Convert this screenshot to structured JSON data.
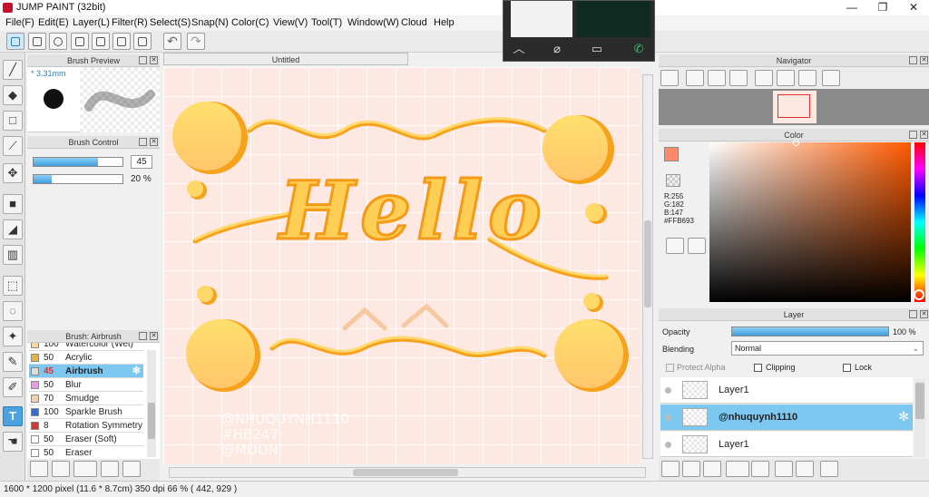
{
  "window": {
    "title": "JUMP PAINT (32bit)",
    "min": "—",
    "max": "❐",
    "close": "✕"
  },
  "menu": [
    "File(F)",
    "Edit(E)",
    "Layer(L)",
    "Filter(R)",
    "Select(S)",
    "Snap(N)",
    "Color(C)",
    "View(V)",
    "Tool(T)",
    "Window(W)",
    "Cloud",
    "Help"
  ],
  "panels": {
    "brush_preview": {
      "title": "Brush Preview",
      "size": "* 3.31mm"
    },
    "brush_control": {
      "title": "Brush Control",
      "size_value": "45",
      "size_fill": 0.72,
      "opacity_value": "20 %",
      "opacity_fill": 0.2
    },
    "brush_list": {
      "title": "Brush: Airbrush",
      "items": [
        {
          "size": "100",
          "name": "Watercolor (Wet)",
          "color": "#f7d89a"
        },
        {
          "size": "50",
          "name": "Acrylic",
          "color": "#e8b53c"
        },
        {
          "size": "45",
          "name": "Airbrush",
          "color": "#4aa3df"
        },
        {
          "size": "50",
          "name": "Blur",
          "color": "#e79be8"
        },
        {
          "size": "70",
          "name": "Smudge",
          "color": "#f4cfa7"
        },
        {
          "size": "100",
          "name": "Sparkle Brush",
          "color": "#2f6ed8"
        },
        {
          "size": "8",
          "name": "Rotation Symmetry P",
          "color": "#e03030"
        },
        {
          "size": "50",
          "name": "Eraser (Soft)",
          "color": "#ffffff"
        },
        {
          "size": "50",
          "name": "Eraser",
          "color": "#ffffff"
        }
      ]
    },
    "document": {
      "tab": "Untitled"
    },
    "navigator": {
      "title": "Navigator"
    },
    "color": {
      "title": "Color",
      "r": "R:255",
      "g": "G:182",
      "b": "B:147",
      "hex": "#FFB693",
      "current": "#ff8a6a"
    },
    "layer": {
      "title": "Layer",
      "opacity_label": "Opacity",
      "opacity_value": "100 %",
      "opacity_fill": 1.0,
      "blending_label": "Blending",
      "blending_value": "Normal",
      "protect_alpha": "Protect Alpha",
      "clipping": "Clipping",
      "lock": "Lock",
      "layers": [
        {
          "name": "Layer1",
          "selected": false
        },
        {
          "name": "@nhuquynh1110",
          "selected": true
        },
        {
          "name": "Layer1",
          "selected": false
        }
      ]
    }
  },
  "canvas_art": {
    "hello_text": "Hello",
    "caption_lines": [
      "@NHUQUYNH1110",
      "#HB247",
      "@MOON"
    ],
    "background": "#fde8e2",
    "accent": "#f5a623"
  },
  "status": {
    "text": "1600 * 1200 pixel   (11.6 * 8.7cm)   350 dpi   66 %   ( 442, 929 )"
  }
}
